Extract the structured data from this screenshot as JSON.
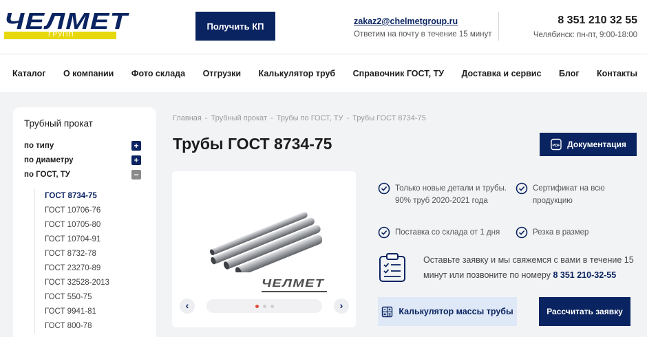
{
  "header": {
    "logo_word": "ЧЕЛМЕТ",
    "logo_sub": "ГРУПП",
    "kp_button": "Получить КП",
    "email": "zakaz2@chelmetgroup.ru",
    "email_note": "Ответим на почту в течение 15 минут",
    "phone": "8 351 210 32 55",
    "phone_hours": "Челябинск: пн-пт, 9:00-18:00"
  },
  "nav": {
    "items": [
      "Каталог",
      "О компании",
      "Фото склада",
      "Отгрузки",
      "Калькулятор труб",
      "Справочник ГОСТ, ТУ",
      "Доставка и сервис",
      "Блог",
      "Контакты"
    ]
  },
  "sidebar": {
    "title": "Трубный прокат",
    "filters": [
      {
        "label": "по типу",
        "toggle": "+"
      },
      {
        "label": "по диаметру",
        "toggle": "+"
      },
      {
        "label": "по ГОСТ, ТУ",
        "toggle": "−"
      }
    ],
    "gost_items": [
      "ГОСТ 8734-75",
      "ГОСТ 10706-76",
      "ГОСТ 10705-80",
      "ГОСТ 10704-91",
      "ГОСТ 8732-78",
      "ГОСТ 23270-89",
      "ГОСТ 32528-2013",
      "ГОСТ 550-75",
      "ГОСТ 9941-81",
      "ГОСТ 800-78"
    ]
  },
  "breadcrumb": [
    "Главная",
    "Трубный прокат",
    "Трубы по ГОСТ, ТУ",
    "Трубы ГОСТ 8734-75"
  ],
  "breadcrumb_sep": "-",
  "page_title": "Трубы ГОСТ 8734-75",
  "doc_button": "Документация",
  "product": {
    "image_logo": "ЧЕЛМЕТ",
    "prev": "‹",
    "next": "›",
    "slide_count": 3,
    "active_slide": 1
  },
  "features": [
    "Только новые детали и трубы. 90% труб 2020-2021 года",
    "Сертификат на всю продукцию",
    "Поставка со склада от 1 дня",
    "Резка в размер"
  ],
  "callback": {
    "text": "Оставьте заявку и мы свяжемся с вами в течение 15 минут или позвоните по номеру",
    "phone": "8 351 210-32-55"
  },
  "calc_button": "Калькулятор массы трубы",
  "order_button": "Рассчитать заявку",
  "colors": {
    "brand_navy": "#0a2461",
    "brand_yellow": "#e7d80e",
    "active_dot": "#e24d3a",
    "content_bg": "#f2f3f5"
  }
}
